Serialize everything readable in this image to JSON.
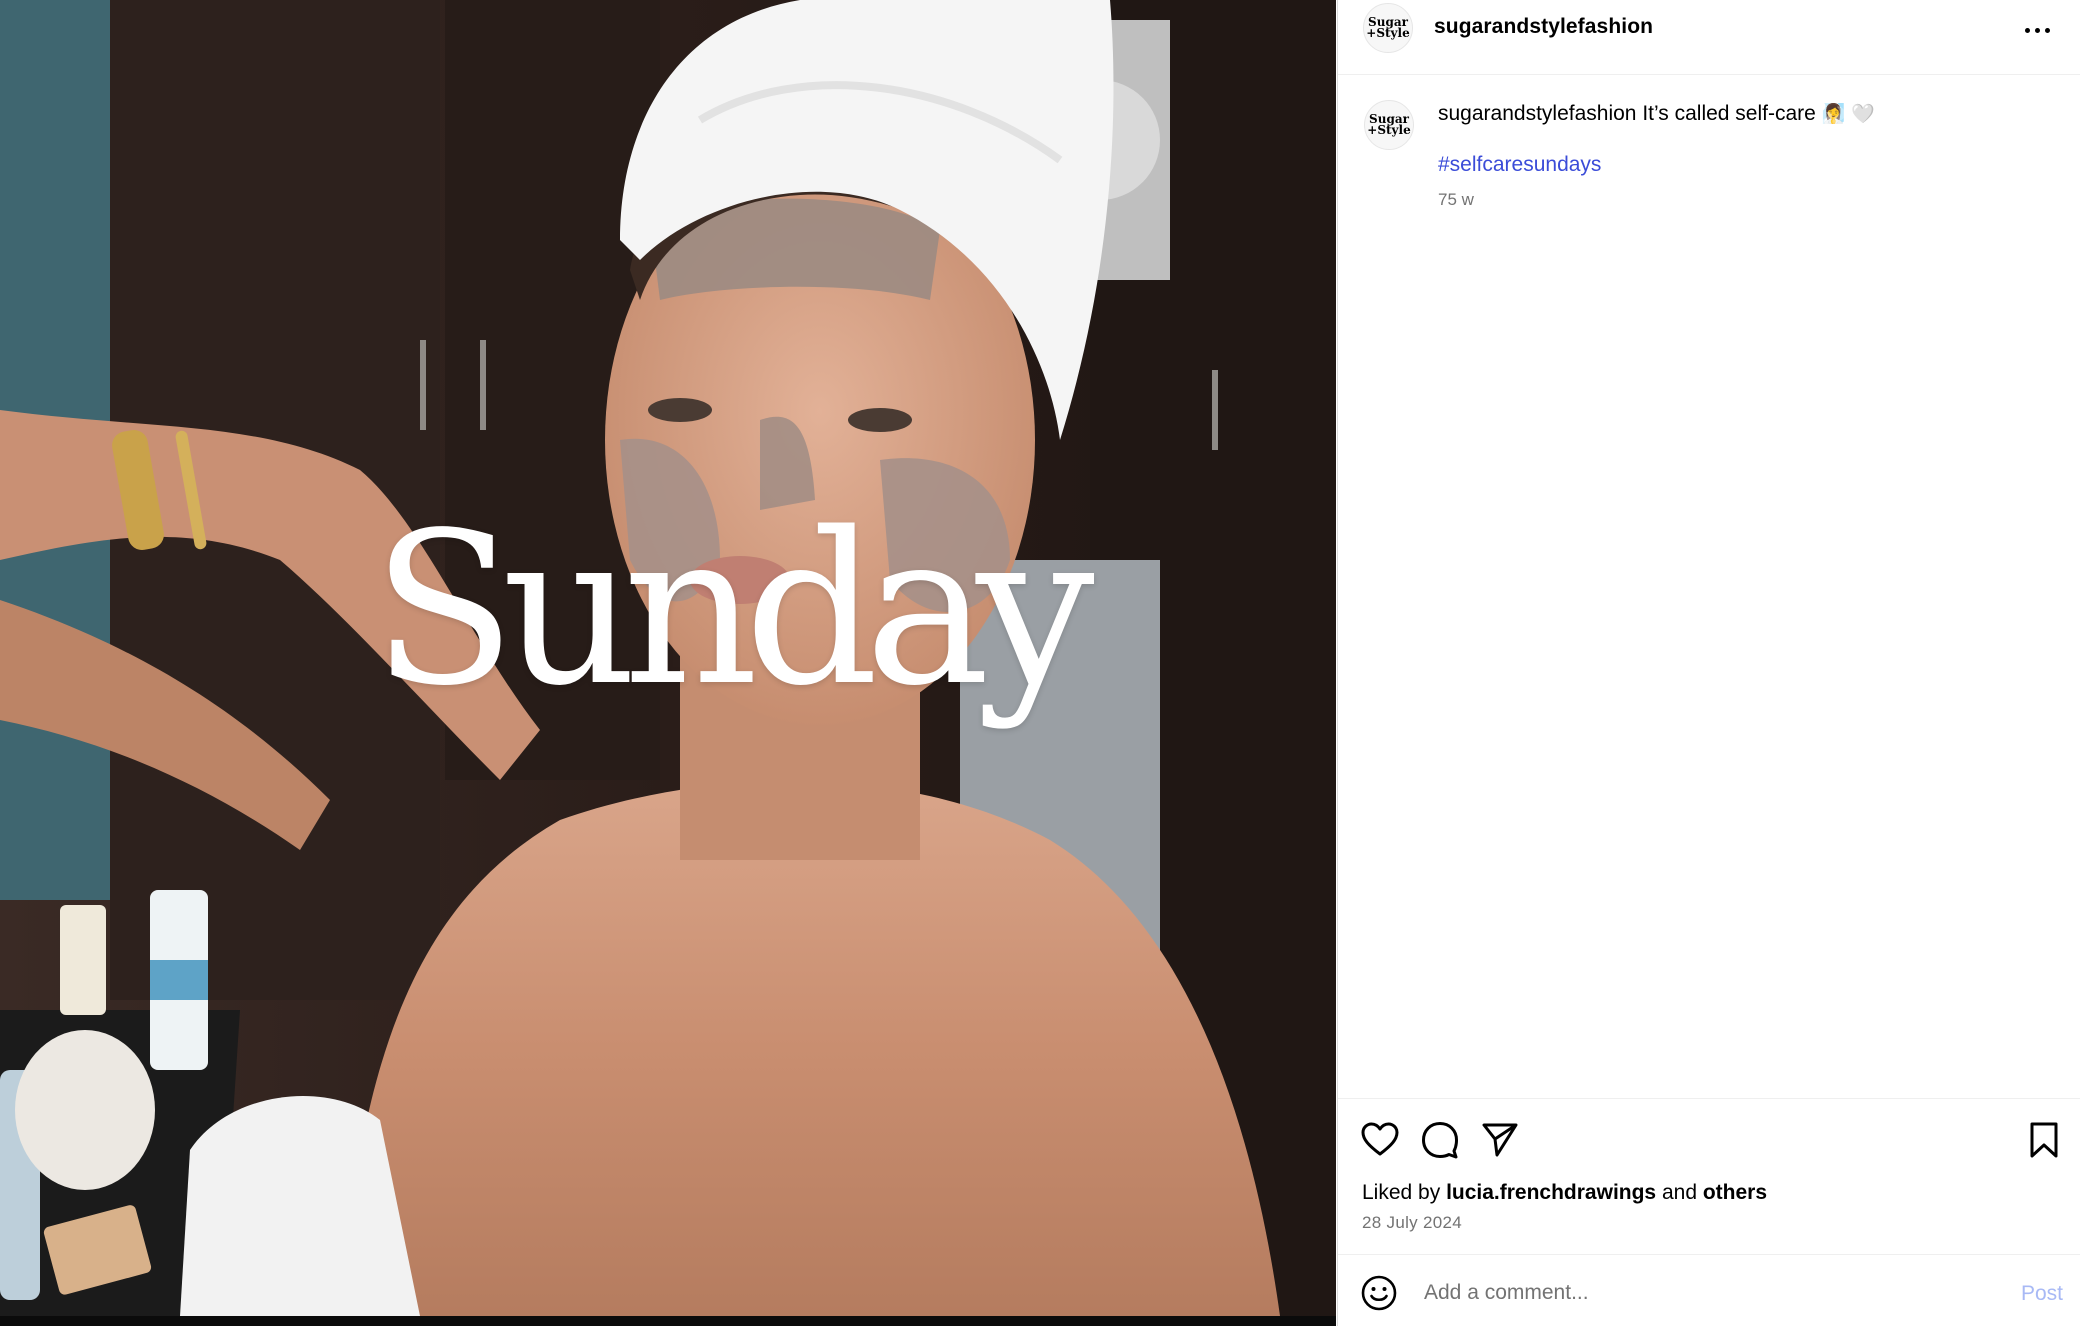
{
  "post": {
    "username": "sugarandstylefashion",
    "avatar_text_line1": "Sugar",
    "avatar_text_line2": "+Style",
    "overlay_text": "Sunday",
    "caption": {
      "username": "sugarandstylefashion",
      "text": "It’s called self-care",
      "emoji1": "🧖‍♀️",
      "emoji2": "🤍",
      "hashtag": "#selfcaresundays",
      "age": "75 w"
    },
    "likes": {
      "prefix": "Liked by",
      "user": "lucia.frenchdrawings",
      "conj": "and",
      "others": "others"
    },
    "date": "28 July 2024"
  },
  "comment": {
    "placeholder": "Add a comment...",
    "post_label": "Post"
  },
  "icons": {
    "more": "more-options-icon",
    "like": "heart-icon",
    "comment": "comment-bubble-icon",
    "share": "send-icon",
    "save": "bookmark-icon",
    "emoji": "emoji-smile-icon"
  },
  "colors": {
    "hashtag": "#3b4cd8",
    "post_button": "#a8b9f5",
    "muted_text": "#737373",
    "divider": "#efefef"
  }
}
